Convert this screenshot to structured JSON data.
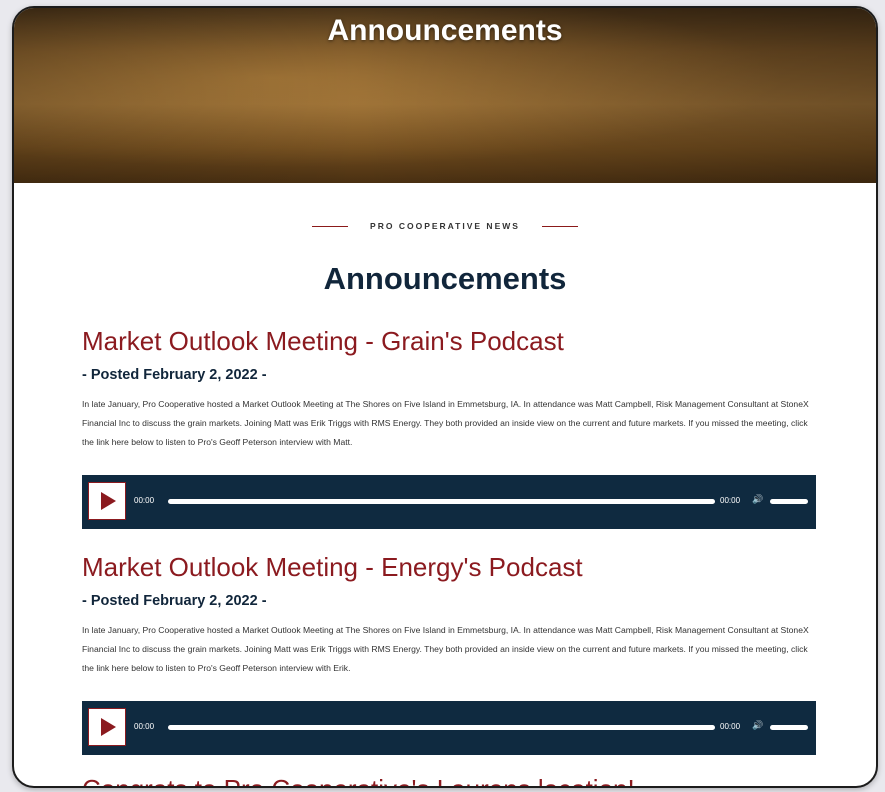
{
  "hero": {
    "title": "Announcements"
  },
  "eyebrow": "PRO COOPERATIVE NEWS",
  "section_title": "Announcements",
  "posts": [
    {
      "title": "Market Outlook Meeting - Grain's Podcast",
      "date": "- Posted February 2, 2022 -",
      "body": "In late January, Pro Cooperative hosted a Market Outlook Meeting at The Shores on Five Island in Emmetsburg, IA. In attendance was Matt Campbell, Risk Management Consultant at StoneX Financial Inc to discuss the grain markets. Joining Matt was Erik Triggs with RMS Energy. They both provided an inside view on the current and future markets. If you missed the meeting, click the link here below to listen to Pro's Geoff Peterson interview with Matt.",
      "player": {
        "current": "00:00",
        "duration": "00:00"
      }
    },
    {
      "title": "Market Outlook Meeting - Energy's Podcast",
      "date": "- Posted February 2, 2022 -",
      "body": "In late January, Pro Cooperative hosted a Market Outlook Meeting at The Shores on Five Island in Emmetsburg, IA. In attendance was Matt Campbell, Risk Management Consultant at StoneX Financial Inc to discuss the grain markets. Joining Matt was Erik Triggs with RMS Energy. They both provided an inside view on the current and future markets. If you missed the meeting, click the link here below to listen to Pro's Geoff Peterson interview with Erik.",
      "player": {
        "current": "00:00",
        "duration": "00:00"
      }
    },
    {
      "title": "Congrats to Pro Cooperative's Laurens location!"
    }
  ],
  "colors": {
    "accent": "#8b1a1f",
    "navy": "#0f2a40",
    "heading": "#11263b"
  }
}
